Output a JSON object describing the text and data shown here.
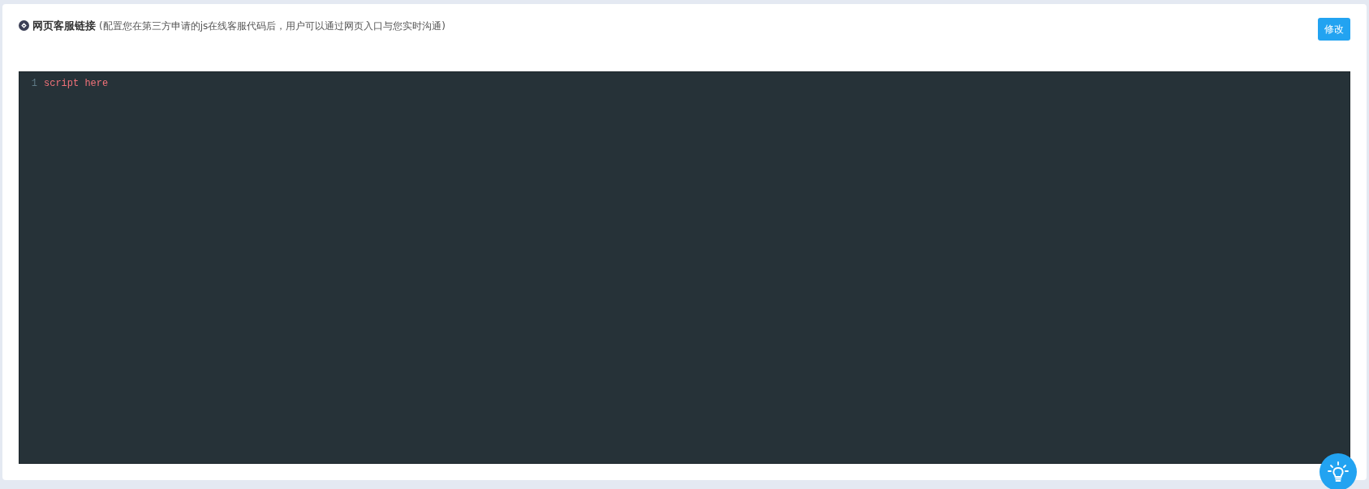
{
  "header": {
    "title": "网页客服链接",
    "hint": "(配置您在第三方申请的js在线客服代码后，用户可以通过网页入口与您实时沟通)",
    "edit_button": "修改"
  },
  "editor": {
    "lines": [
      {
        "number": "1",
        "code": "script here"
      }
    ]
  }
}
